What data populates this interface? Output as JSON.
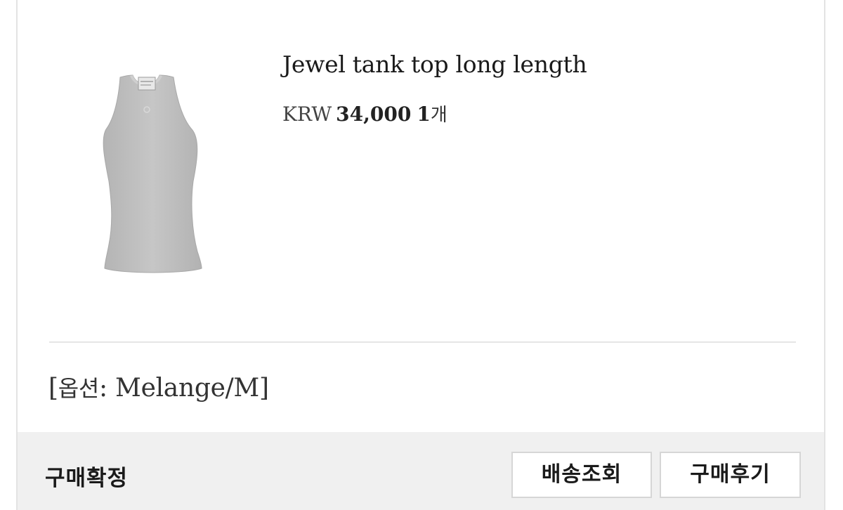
{
  "product": {
    "image_icon": "tank-top-image",
    "name": "Jewel tank top long length",
    "currency": "KRW",
    "price": "34,000",
    "quantity": "1",
    "quantity_unit": "개"
  },
  "option": {
    "open_bracket": "[",
    "label": "옵션",
    "separator": ": ",
    "value": "Melange/M",
    "close_bracket": "]"
  },
  "footer": {
    "status": "구매확정",
    "tracking_button": "배송조회",
    "review_button": "구매후기"
  },
  "colors": {
    "background": "#ffffff",
    "footer_bg": "#f0f0f0",
    "border": "#d6d6d6",
    "garment": "#bdbdbd"
  }
}
